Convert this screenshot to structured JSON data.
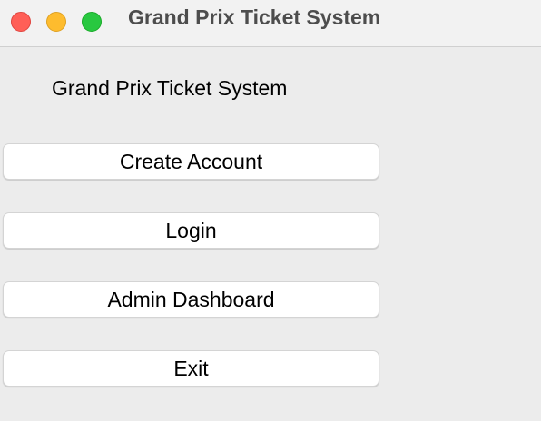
{
  "window": {
    "title": "Grand Prix Ticket System",
    "controls": {
      "close_color": "#ff5f57",
      "minimize_color": "#febc2e",
      "zoom_color": "#28c840"
    }
  },
  "main": {
    "heading": "Grand Prix Ticket System",
    "buttons": [
      {
        "label": "Create Account"
      },
      {
        "label": "Login"
      },
      {
        "label": "Admin Dashboard"
      },
      {
        "label": "Exit"
      }
    ]
  }
}
